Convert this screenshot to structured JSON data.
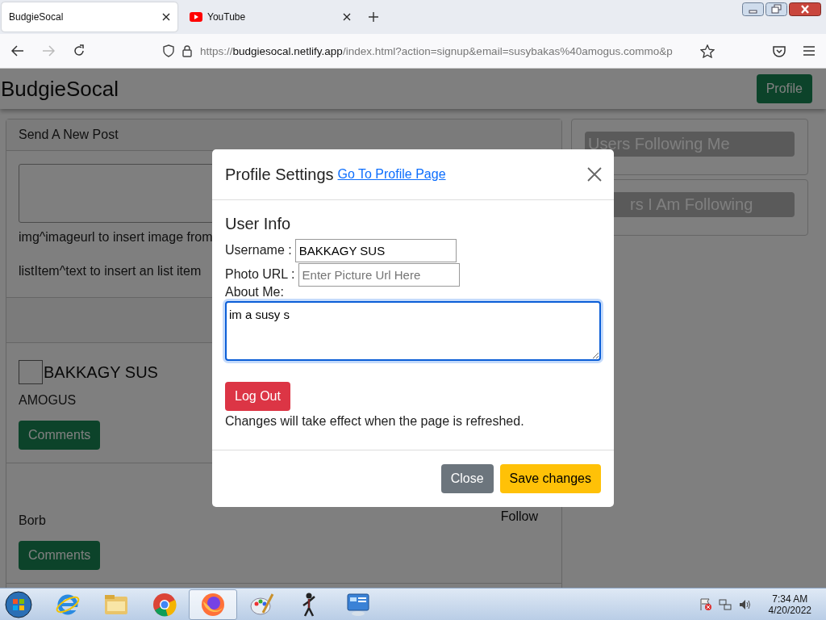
{
  "browser": {
    "tabs": [
      {
        "title": "BudgieSocal",
        "selected": true,
        "kind": "blank"
      },
      {
        "title": "YouTube",
        "selected": false,
        "kind": "youtube"
      }
    ],
    "url": {
      "scheme": "https://",
      "host": "budgiesocal.netlify.app",
      "path": "/index.html?action=signup&email=susybakas%40amogus.commo&p"
    }
  },
  "page": {
    "brand": "BudgieSocal",
    "profile_button": "Profile",
    "new_post": {
      "header": "Send A New Post",
      "hints": [
        "img^imageurl to insert image from",
        "listItem^text to insert an list item"
      ]
    },
    "posts": [
      {
        "author": "BAKKAGY SUS",
        "text": "AMOGUS",
        "button": "Comments"
      },
      {
        "follow": "Follow",
        "text": "Borb",
        "button": "Comments"
      }
    ],
    "sidebar": [
      {
        "label": "Users Following Me"
      },
      {
        "label": "rs I Am Following"
      }
    ]
  },
  "modal": {
    "title": "Profile Settings",
    "link": "Go To Profile Page",
    "section": "User Info",
    "username": {
      "label": "Username :",
      "value": "BAKKAGY SUS"
    },
    "photo": {
      "label": "Photo URL :",
      "placeholder": "Enter Picture Url Here"
    },
    "about": {
      "label": "About Me:",
      "value": "im a susy s"
    },
    "logout": "Log Out",
    "note": "Changes will take effect when the page is refreshed.",
    "buttons": [
      {
        "label": "Close",
        "kind": "secondary"
      },
      {
        "label": "Save changes",
        "kind": "warning"
      }
    ]
  },
  "taskbar": {
    "apps": [
      {
        "kind": "ie",
        "selected": false
      },
      {
        "kind": "folder",
        "selected": false
      },
      {
        "kind": "chrome",
        "selected": false
      },
      {
        "kind": "firefox",
        "selected": true
      },
      {
        "kind": "paint",
        "selected": false
      },
      {
        "kind": "stickman",
        "selected": false
      },
      {
        "kind": "panel",
        "selected": false
      }
    ],
    "time": "7:34 AM",
    "date": "4/20/2022"
  }
}
